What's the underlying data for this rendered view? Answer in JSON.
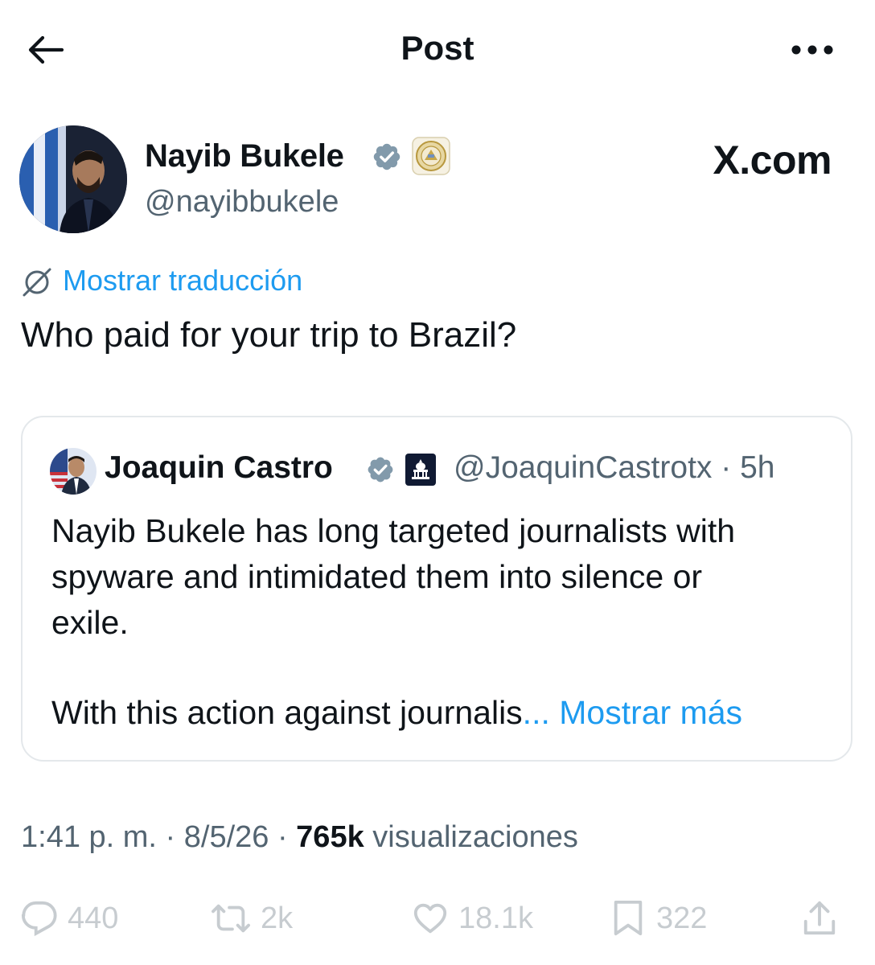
{
  "header": {
    "title": "Post"
  },
  "author": {
    "name": "Nayib Bukele",
    "handle": "@nayibbukele",
    "watermark": "X.com"
  },
  "translate": {
    "label": "Mostrar traducción"
  },
  "post": {
    "text": "Who paid for your trip to Brazil?"
  },
  "quote": {
    "name": "Joaquin Castro",
    "handle": "@JoaquinCastrotx · 5h",
    "text": "Nayib Bukele has long targeted journalists with\nspyware and intimidated them into silence or\nexile.",
    "last_line": "With this action against journalis",
    "ellipsis": "...",
    "show_more": " Mostrar más"
  },
  "meta": {
    "time": "1:41 p. m. · 8/5/26 · ",
    "views_count": "765k",
    "views_label": " visualizaciones"
  },
  "actions": {
    "reply_count": "440",
    "repost_count": "2k",
    "like_count": "18.1k",
    "bookmark_count": "322"
  },
  "colors": {
    "accent": "#1d9bf0",
    "text": "#0f1419",
    "secondary": "#536471",
    "border": "#e4e8eb"
  }
}
